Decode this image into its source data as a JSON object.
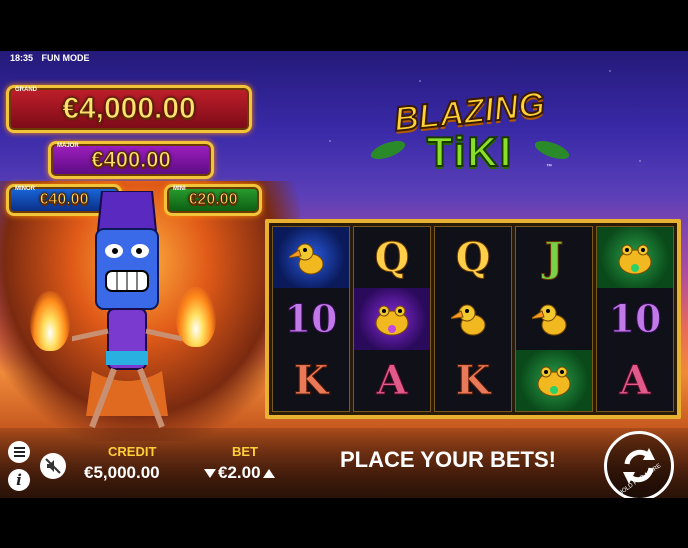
{
  "status": {
    "time": "18:35",
    "mode": "FUN MODE"
  },
  "jackpots": {
    "grand": {
      "tag": "GRAND",
      "amount": "€4,000.00"
    },
    "major": {
      "tag": "MAJOR",
      "amount": "€400.00"
    },
    "minor": {
      "tag": "MINOR",
      "amount": "€40.00"
    },
    "mini": {
      "tag": "MINI",
      "amount": "€20.00"
    }
  },
  "logo": {
    "line1": "BLAZING",
    "line2": "TiKI",
    "tm": "™"
  },
  "reels": [
    [
      "toucan-blue",
      "10",
      "K"
    ],
    [
      "Q",
      "frog-purple",
      "A"
    ],
    [
      "Q",
      "toucan",
      "K"
    ],
    [
      "J",
      "toucan",
      "frog-green"
    ],
    [
      "frog-green",
      "10",
      "A"
    ]
  ],
  "footer": {
    "credit_label": "CREDIT",
    "credit_value": "€5,000.00",
    "bet_label": "BET",
    "bet_value": "€2.00",
    "message": "PLACE YOUR BETS!",
    "spin_hint": "HOLD FOR MORE"
  },
  "icons": {
    "menu": "menu-icon",
    "info": "info-icon",
    "sound": "sound-off-icon",
    "spin": "spin-icon"
  },
  "colors": {
    "accent_gold": "#ffcf3a",
    "reel_frame": "#e8b230"
  }
}
